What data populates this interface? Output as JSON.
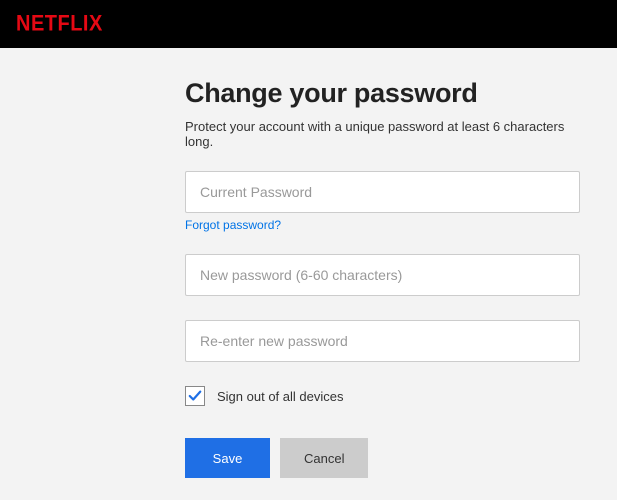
{
  "header": {
    "logo": "NETFLIX"
  },
  "page": {
    "title": "Change your password",
    "subtitle": "Protect your account with a unique password at least 6 characters long."
  },
  "form": {
    "current_password": {
      "placeholder": "Current Password",
      "value": ""
    },
    "forgot_link": "Forgot password?",
    "new_password": {
      "placeholder": "New password (6-60 characters)",
      "value": ""
    },
    "confirm_password": {
      "placeholder": "Re-enter new password",
      "value": ""
    },
    "signout_checkbox": {
      "label": "Sign out of all devices",
      "checked": true
    },
    "buttons": {
      "save": "Save",
      "cancel": "Cancel"
    }
  }
}
